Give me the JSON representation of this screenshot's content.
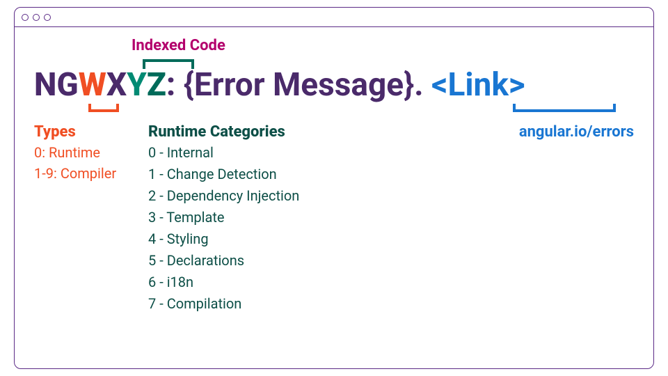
{
  "labels": {
    "indexed_code": "Indexed Code",
    "types_heading": "Types",
    "categories_heading": "Runtime Categories",
    "reference_url": "angular.io/errors"
  },
  "pattern": {
    "prefix": "NG",
    "type_placeholder": "W",
    "category_placeholder": "X",
    "index_placeholder_1": "Y",
    "index_placeholder_2": "Z",
    "separator": ": ",
    "message_placeholder": "{Error Message}. ",
    "link_placeholder": "<Link>"
  },
  "types": [
    {
      "code": "0",
      "label": "Runtime"
    },
    {
      "code": "1-9",
      "label": "Compiler"
    }
  ],
  "runtime_categories": [
    {
      "code": "0",
      "label": "Internal"
    },
    {
      "code": "1",
      "label": "Change Detection"
    },
    {
      "code": "2",
      "label": "Dependency Injection"
    },
    {
      "code": "3",
      "label": "Template"
    },
    {
      "code": "4",
      "label": "Styling"
    },
    {
      "code": "5",
      "label": "Declarations"
    },
    {
      "code": "6",
      "label": "i18n"
    },
    {
      "code": "7",
      "label": "Compilation"
    }
  ],
  "colors": {
    "frame": "#5b2a86",
    "accent_magenta": "#b3006c",
    "accent_orange": "#f04e23",
    "accent_teal_dark": "#0d4f47",
    "accent_teal": "#008a73",
    "accent_blue": "#1976d2",
    "text_purple": "#4a2a6a"
  }
}
